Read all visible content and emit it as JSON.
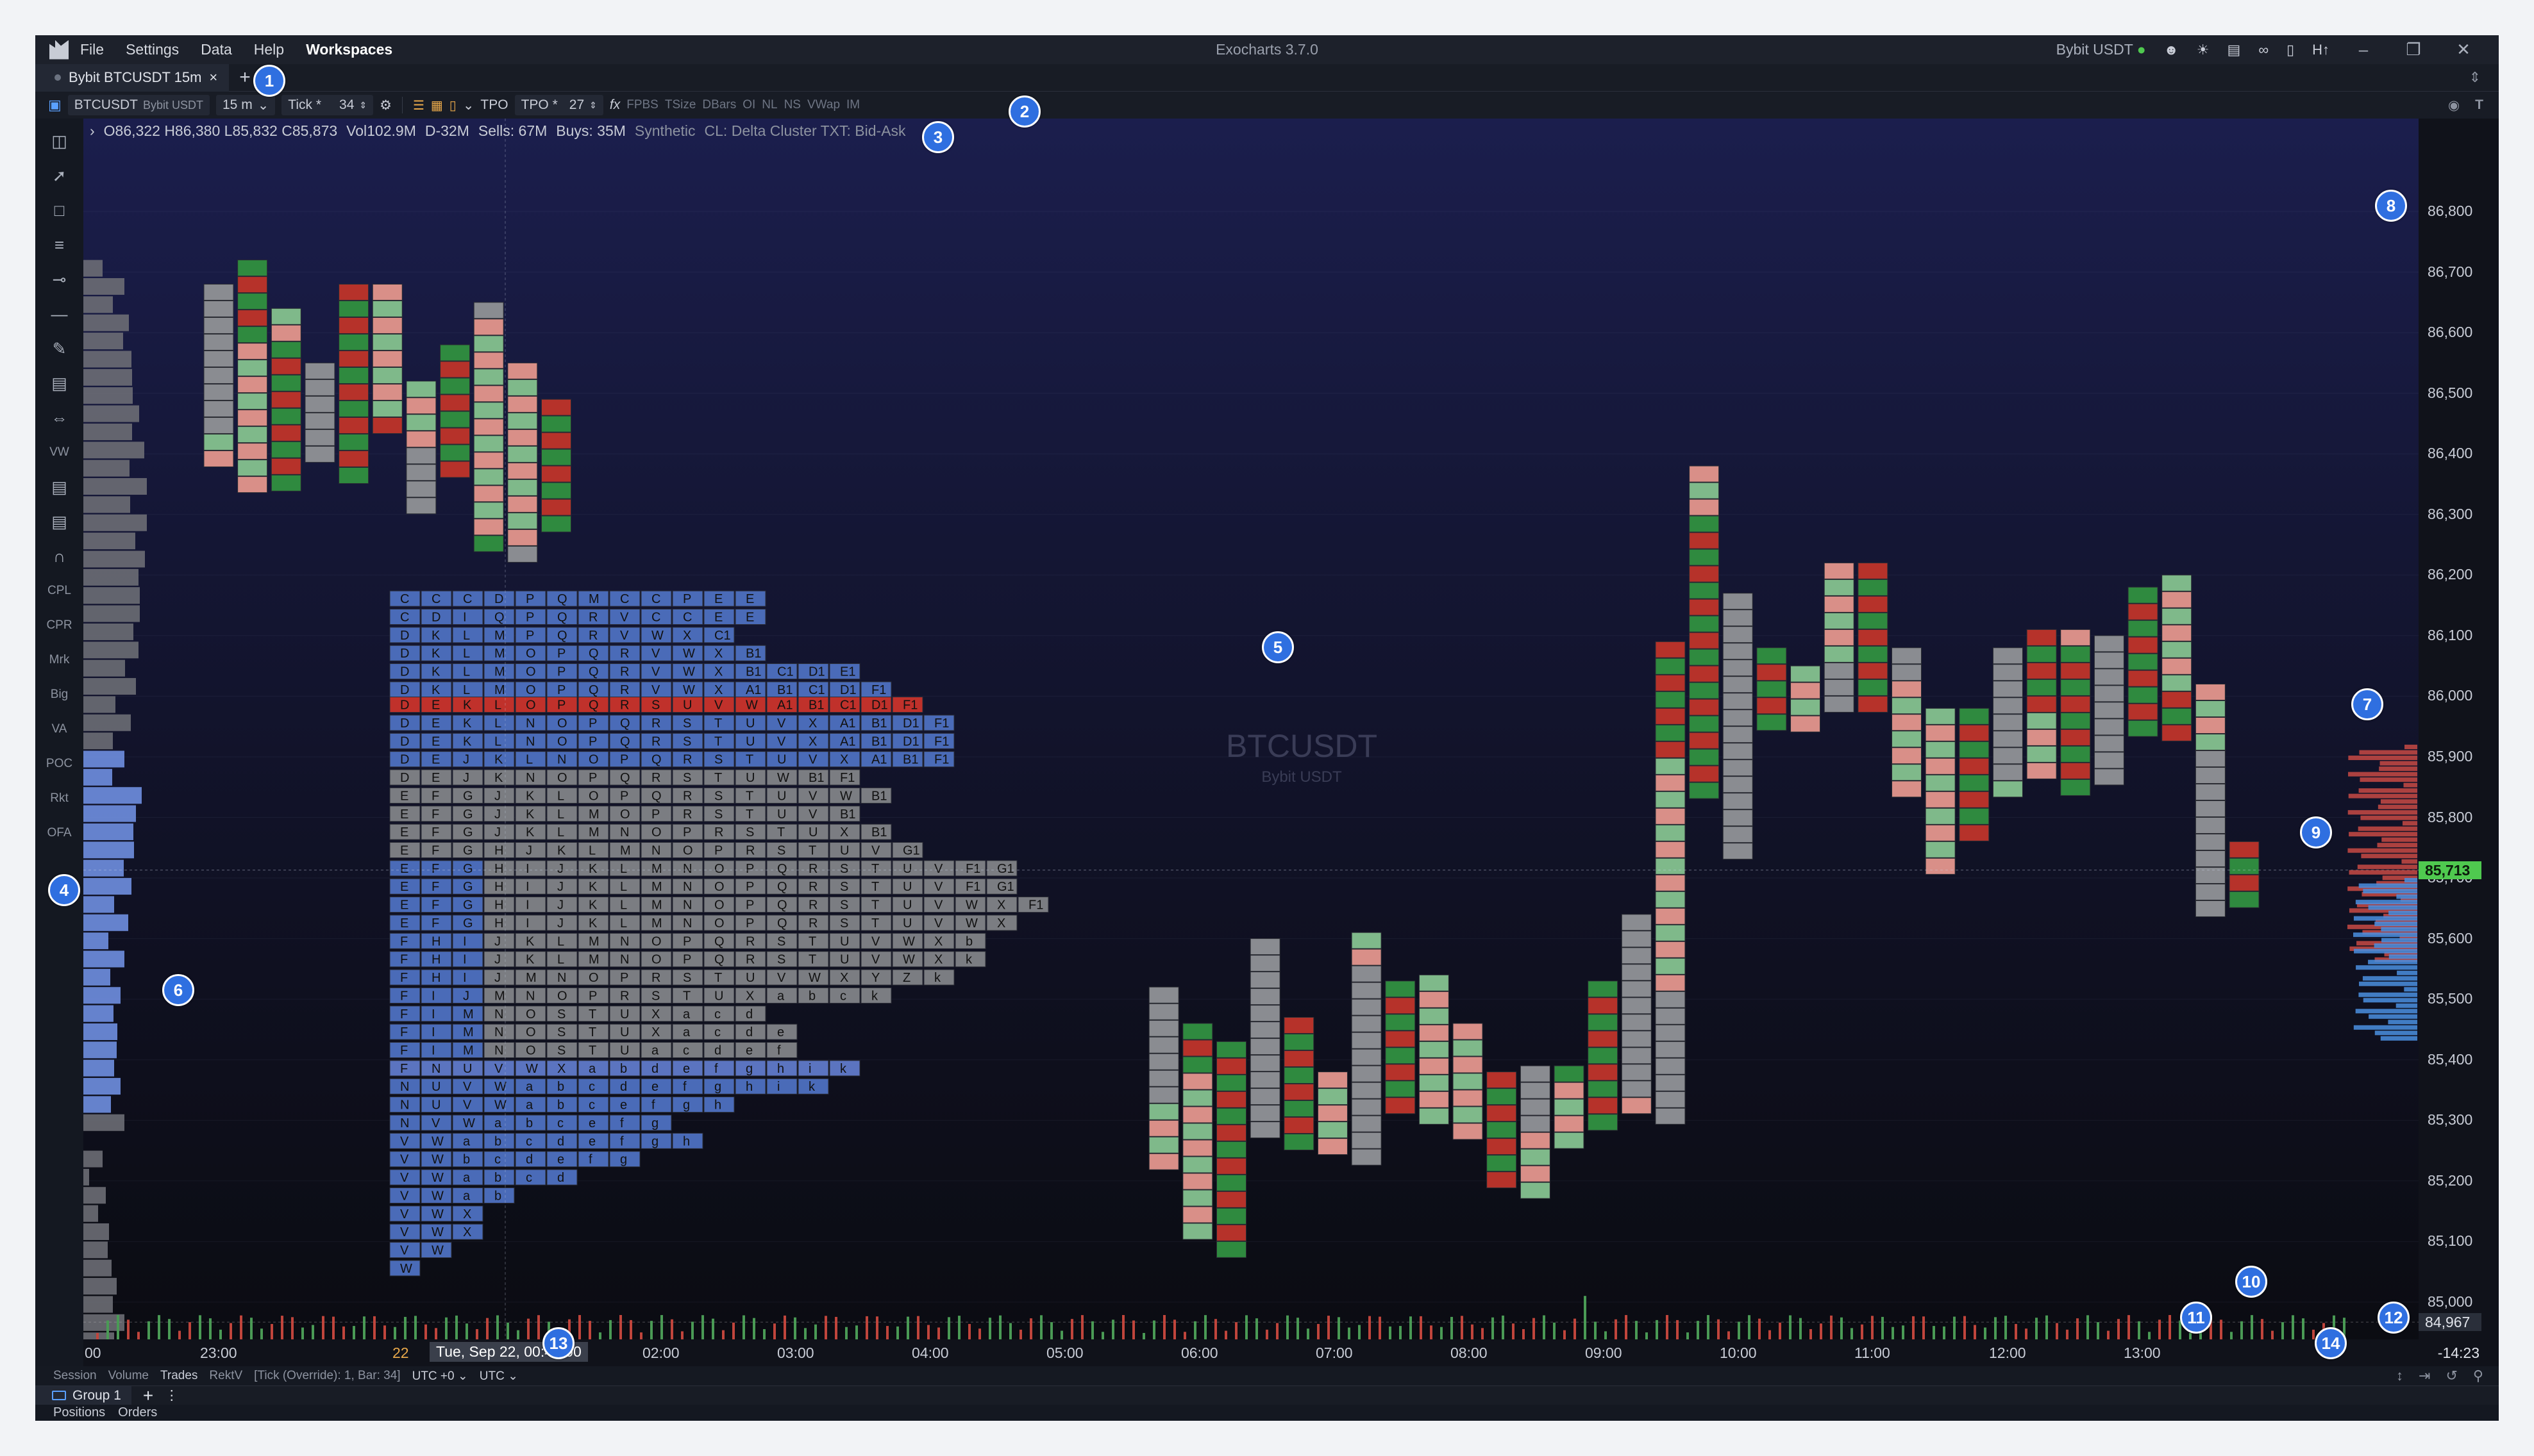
{
  "window": {
    "title": "Exocharts 3.7.0",
    "menu": [
      "File",
      "Settings",
      "Data",
      "Help",
      "Workspaces"
    ],
    "account": "Bybit USDT",
    "account_status": "●",
    "ht_label": "H↑"
  },
  "tabs": [
    {
      "label": "Bybit BTCUSDT 15m",
      "close": "×"
    }
  ],
  "toolbar": {
    "symbol": "BTCUSDT",
    "exchange": "Bybit USDT",
    "timeframe": "15 m",
    "tick_label": "Tick *",
    "tick_value": "34",
    "tpo_label": "TPO",
    "tpo_setting_label": "TPO *",
    "tpo_setting_value": "27",
    "fx": "fx",
    "indicators": [
      "FPBS",
      "TSize",
      "DBars",
      "OI",
      "NL",
      "NS",
      "VWap",
      "IM"
    ]
  },
  "ohlc": {
    "open": "O86,322",
    "high": "H86,380",
    "low": "L85,832",
    "close": "C85,873",
    "volume": "Vol102.9M",
    "delta": "D-32M",
    "sells": "Sells: 67M",
    "buys": "Buys: 35M",
    "mode": "Synthetic",
    "cluster": "CL: Delta Cluster TXT: Bid-Ask"
  },
  "watermark": {
    "symbol": "BTCUSDT",
    "exchange": "Bybit USDT"
  },
  "left_tools": {
    "icons": [
      "layout-icon",
      "line-tool-icon",
      "rectangle-icon",
      "parallel-lines-icon",
      "horizontal-ray-icon",
      "horizontal-line-icon",
      "brush-icon",
      "text-icon",
      "range-icon"
    ],
    "labels_top": [
      "VW"
    ],
    "icons_mid": [
      "profile-icon",
      "notes-icon",
      "magnet-icon"
    ],
    "labels": [
      "CPL",
      "CPR",
      "Mrk",
      "Big",
      "VA",
      "POC",
      "Rkt",
      "OFA"
    ]
  },
  "price_axis": {
    "ticks": [
      "86,800",
      "86,700",
      "86,600",
      "86,500",
      "86,400",
      "86,300",
      "86,200",
      "86,100",
      "86,000",
      "85,900",
      "85,800",
      "85,700",
      "85,600",
      "85,500",
      "85,400",
      "85,300",
      "85,200",
      "85,100",
      "85,000"
    ],
    "current_price": "85,713",
    "low_price": "84,967"
  },
  "time_axis": {
    "labels": [
      "00",
      "23:00",
      "22",
      "01:00",
      "02:00",
      "03:00",
      "04:00",
      "05:00",
      "06:00",
      "07:00",
      "08:00",
      "09:00",
      "10:00",
      "11:00",
      "12:00",
      "13:00"
    ],
    "cursor": "Tue, Sep 22, 00:45:00",
    "countdown": "-14:23"
  },
  "status": {
    "items": [
      "Session",
      "Volume",
      "Trades",
      "RektV"
    ],
    "tick_info": "[Tick (Override): 1, Bar: 34]",
    "tz1": "UTC +0",
    "tz2": "UTC"
  },
  "groups": {
    "label": "Group 1",
    "plus": "+",
    "more": "⋮"
  },
  "bottom_tabs": [
    "Positions",
    "Orders"
  ],
  "tpo_profile": {
    "rows": [
      {
        "price": 86160,
        "letters": "CCCDPQMCCPEE"
      },
      {
        "price": 86130,
        "letters": "CDIQPQRVCCEE"
      },
      {
        "price": 86100,
        "letters": "DKLMPQRVWXC1"
      },
      {
        "price": 86070,
        "letters": "DKLMOPQRVWXB1"
      },
      {
        "price": 86040,
        "letters": "DKLMOPQRVWXB1C1D1E1"
      },
      {
        "price": 86010,
        "letters": "DKLMOPQRVWXA1B1C1D1F1"
      },
      {
        "price": 85985,
        "letters": "DEKLOPQRSUVWA1B1C1D1F1"
      },
      {
        "price": 85955,
        "letters": "DEKLNOPQRSTUVXA1B1D1F1"
      },
      {
        "price": 85925,
        "letters": "DEKLNOPQRSTUVXA1B1D1F1"
      },
      {
        "price": 85895,
        "letters": "DEJKLNOPQRSTUVXA1B1F1"
      },
      {
        "price": 85865,
        "letters": "DEJKNOPQRSTUWB1F1"
      },
      {
        "price": 85835,
        "letters": "EFGJKLOPQRSTUVWB1"
      },
      {
        "price": 85805,
        "letters": "EFGJKLMOPRSTUVB1"
      },
      {
        "price": 85775,
        "letters": "EFGJKLMNOPRSTUXB1"
      },
      {
        "price": 85745,
        "letters": "EFGHJKLMNOPRSTUVG1"
      },
      {
        "price": 85715,
        "letters": "EFGHIJKLMNOPQRSTUVF1G1"
      },
      {
        "price": 85685,
        "letters": "EFGHIJKLMNOPQRSTUVF1G1"
      },
      {
        "price": 85655,
        "letters": "EFGHIJKLMNOPQRSTUVWXF1"
      },
      {
        "price": 85625,
        "letters": "EFGHIJKLMNOPQRSTUVWX"
      },
      {
        "price": 85595,
        "letters": "FHIJKLMNOPQRSTUVWXb"
      },
      {
        "price": 85565,
        "letters": "FHIJKLMNOPQRSTUVWXk"
      },
      {
        "price": 85535,
        "letters": "FHIJMNOPRSTUVWXYZk"
      },
      {
        "price": 85505,
        "letters": "FIJMNOPRSTUXabck"
      },
      {
        "price": 85475,
        "letters": "FIMNOSTUXacd"
      },
      {
        "price": 85445,
        "letters": "FIMNOSTUXacde"
      },
      {
        "price": 85415,
        "letters": "FIMNOSTUacdef"
      },
      {
        "price": 85385,
        "letters": "FNUVWXabdefghik"
      },
      {
        "price": 85355,
        "letters": "NUVWabcdefghik"
      },
      {
        "price": 85325,
        "letters": "NUVWabcefgh"
      },
      {
        "price": 85295,
        "letters": "NVWabcefg"
      },
      {
        "price": 85265,
        "letters": "VWabcdefgh"
      },
      {
        "price": 85235,
        "letters": "VWbcdefg"
      },
      {
        "price": 85205,
        "letters": "VWabcd"
      },
      {
        "price": 85175,
        "letters": "VWab"
      },
      {
        "price": 85145,
        "letters": "VWX"
      },
      {
        "price": 85115,
        "letters": "VWX"
      },
      {
        "price": 85085,
        "letters": "VW"
      },
      {
        "price": 85055,
        "letters": "W"
      }
    ],
    "highlight_row_price": 85985,
    "poc_row_price": 85385
  },
  "cluster_bars": [
    {
      "time": "22:15",
      "high": 86680,
      "low": 86380
    },
    {
      "time": "22:30",
      "high": 86720,
      "low": 86340
    },
    {
      "time": "22:45",
      "high": 86640,
      "low": 86350
    },
    {
      "time": "23:00",
      "high": 86550,
      "low": 86390
    },
    {
      "time": "23:15",
      "high": 86680,
      "low": 86360
    },
    {
      "time": "23:30",
      "high": 86680,
      "low": 86420
    },
    {
      "time": "23:45",
      "high": 86520,
      "low": 86310
    },
    {
      "time": "00:00",
      "high": 86580,
      "low": 86350
    },
    {
      "time": "00:15",
      "high": 86650,
      "low": 86250
    },
    {
      "time": "00:30",
      "high": 86550,
      "low": 86210
    },
    {
      "time": "00:45",
      "high": 86490,
      "low": 86280
    },
    {
      "time": "05:15",
      "high": 85520,
      "low": 85210
    },
    {
      "time": "05:30",
      "high": 85460,
      "low": 85100
    },
    {
      "time": "05:45",
      "high": 85430,
      "low": 85070
    },
    {
      "time": "06:00",
      "high": 85600,
      "low": 85270
    },
    {
      "time": "06:15",
      "high": 85470,
      "low": 85260
    },
    {
      "time": "06:30",
      "high": 85380,
      "low": 85230
    },
    {
      "time": "06:45",
      "high": 85610,
      "low": 85220
    },
    {
      "time": "07:00",
      "high": 85530,
      "low": 85310
    },
    {
      "time": "07:15",
      "high": 85540,
      "low": 85300
    },
    {
      "time": "07:30",
      "high": 85460,
      "low": 85280
    },
    {
      "time": "07:45",
      "high": 85380,
      "low": 85200
    },
    {
      "time": "08:00",
      "high": 85390,
      "low": 85160
    },
    {
      "time": "08:15",
      "high": 85390,
      "low": 85260
    },
    {
      "time": "08:30",
      "high": 85530,
      "low": 85290
    },
    {
      "time": "08:45",
      "high": 85640,
      "low": 85310
    },
    {
      "time": "09:00",
      "high": 86090,
      "low": 85280
    },
    {
      "time": "09:15",
      "high": 86380,
      "low": 85820
    },
    {
      "time": "09:30",
      "high": 86170,
      "low": 85720
    },
    {
      "time": "09:45",
      "high": 86080,
      "low": 85930
    },
    {
      "time": "10:00",
      "high": 86050,
      "low": 85930
    },
    {
      "time": "10:15",
      "high": 86220,
      "low": 85980
    },
    {
      "time": "10:30",
      "high": 86220,
      "low": 85980
    },
    {
      "time": "10:45",
      "high": 86080,
      "low": 85840
    },
    {
      "time": "11:00",
      "high": 85980,
      "low": 85700
    },
    {
      "time": "11:15",
      "high": 85980,
      "low": 85770
    },
    {
      "time": "11:30",
      "high": 86080,
      "low": 85830
    },
    {
      "time": "11:45",
      "high": 86110,
      "low": 85860
    },
    {
      "time": "12:00",
      "high": 86110,
      "low": 85830
    },
    {
      "time": "12:15",
      "high": 86100,
      "low": 85840
    },
    {
      "time": "12:30",
      "high": 86180,
      "low": 85940
    },
    {
      "time": "12:45",
      "high": 86200,
      "low": 85930
    },
    {
      "time": "13:00",
      "high": 86020,
      "low": 85640
    },
    {
      "time": "13:15",
      "high": 85760,
      "low": 85640
    }
  ],
  "callouts": [
    "1",
    "2",
    "3",
    "4",
    "5",
    "6",
    "7",
    "8",
    "9",
    "10",
    "11",
    "12",
    "13",
    "14"
  ],
  "colors": {
    "bg_top": "#1b1e4d",
    "bg_bottom": "#0b0c12",
    "tpo_gray": "#7b7d82",
    "tpo_blue": "#4a6bb8",
    "tpo_highlight": "#c0312b",
    "buy": "#3f9a4f",
    "sell": "#c0453c",
    "current_price": "#4fc94f",
    "callout": "#2f6fe0"
  }
}
